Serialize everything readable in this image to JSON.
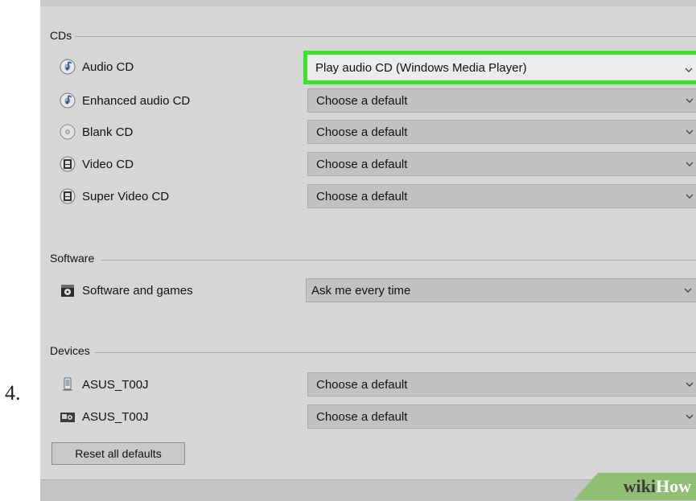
{
  "step_number": "4.",
  "sections": {
    "cds": {
      "title": "CDs",
      "rows": [
        {
          "label": "Audio CD",
          "icon": "audio-cd-icon",
          "value": "Play audio CD (Windows Media Player)"
        },
        {
          "label": "Enhanced audio CD",
          "icon": "audio-cd-icon",
          "value": "Choose a default"
        },
        {
          "label": "Blank CD",
          "icon": "blank-cd-icon",
          "value": "Choose a default"
        },
        {
          "label": "Video CD",
          "icon": "video-cd-icon",
          "value": "Choose a default"
        },
        {
          "label": "Super Video CD",
          "icon": "video-cd-icon",
          "value": "Choose a default"
        }
      ]
    },
    "software": {
      "title": "Software",
      "rows": [
        {
          "label": "Software and games",
          "icon": "software-icon",
          "value": "Ask me every time"
        }
      ]
    },
    "devices": {
      "title": "Devices",
      "rows": [
        {
          "label": "ASUS_T00J",
          "icon": "phone-device-icon",
          "value": "Choose a default"
        },
        {
          "label": "ASUS_T00J",
          "icon": "camera-device-icon",
          "value": "Choose a default"
        }
      ]
    }
  },
  "reset_button": "Reset all defaults",
  "watermark": {
    "wiki": "wiki",
    "how": "How"
  },
  "colors": {
    "highlight": "#39e32b",
    "panel": "#d6d6d6",
    "select": "#c2c2c2"
  }
}
